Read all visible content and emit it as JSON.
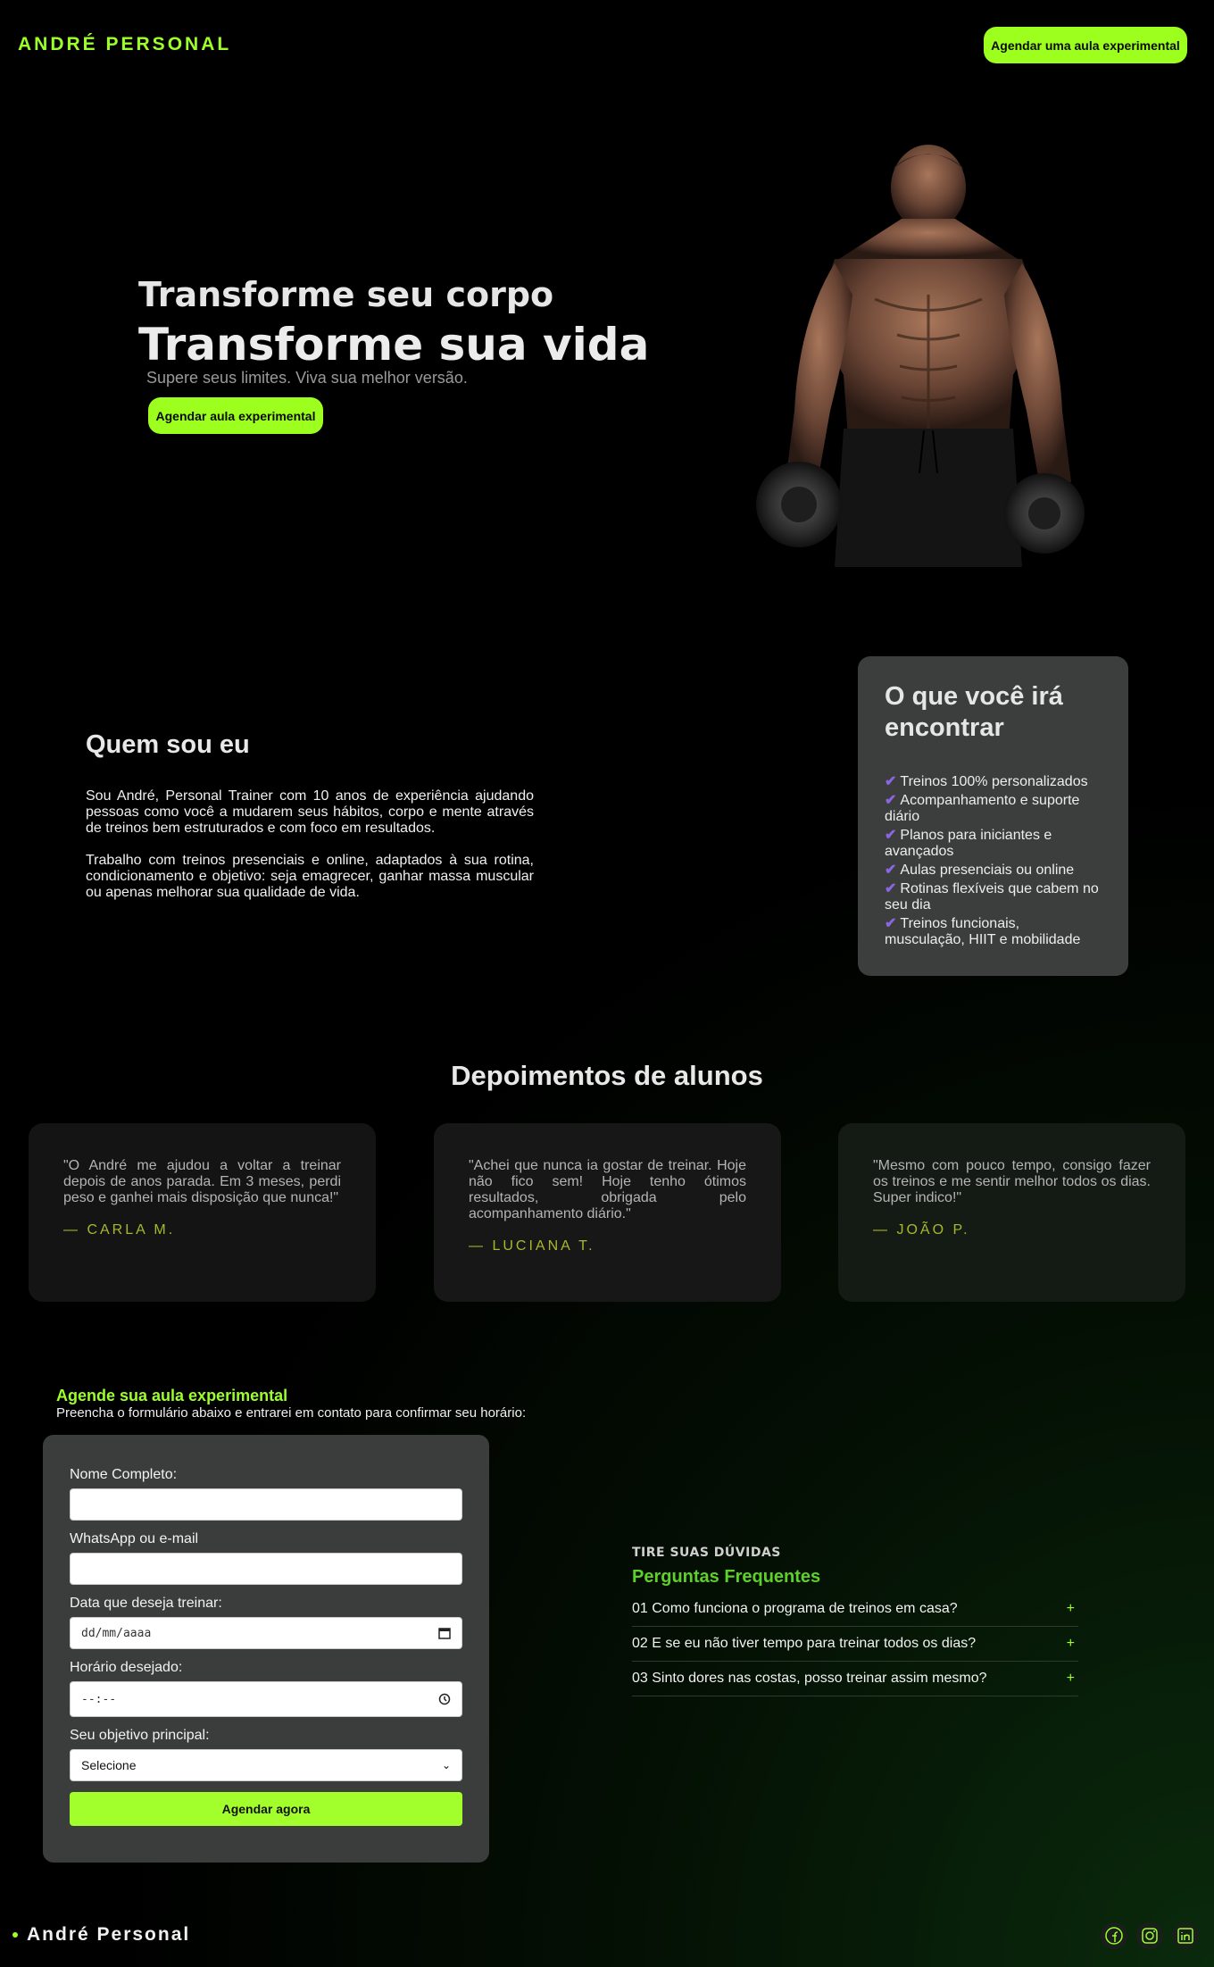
{
  "header": {
    "brand": "ANDRÉ PERSONAL",
    "cta_label": "Agendar uma aula experimental"
  },
  "hero": {
    "line1": "Transforme seu corpo",
    "line2": "Transforme sua vida",
    "subtitle": "Supere seus limites. Viva sua melhor versão.",
    "cta_label": "Agendar aula experimental"
  },
  "about": {
    "title": "Quem sou eu",
    "paragraphs": [
      "Sou André, Personal Trainer com 10 anos de experiência ajudando pessoas como você a mudarem seus hábitos, corpo e mente através de treinos bem estruturados e com foco em resultados.",
      "Trabalho com treinos presenciais e online, adaptados à sua rotina, condicionamento e objetivo: seja emagrecer, ganhar massa muscular ou apenas melhorar sua qualidade de vida."
    ]
  },
  "features": {
    "title": "O que você irá encontrar",
    "items": [
      "Treinos 100% personalizados",
      "Acompanhamento e suporte diário",
      "Planos para iniciantes e avançados",
      "Aulas presenciais ou online",
      "Rotinas flexíveis que cabem no seu dia",
      "Treinos funcionais, musculação, HIIT e mobilidade"
    ]
  },
  "testimonials": {
    "title": "Depoimentos de alunos",
    "items": [
      {
        "quote": "\"O André me ajudou a voltar a treinar depois de anos parada. Em 3 meses, perdi peso e ganhei mais disposição que nunca!\"",
        "author": "— CARLA M."
      },
      {
        "quote": "\"Achei que nunca ia gostar de treinar. Hoje não fico sem! Hoje tenho ótimos resultados, obrigada pelo acompanhamento diário.\"",
        "author": "— LUCIANA T."
      },
      {
        "quote": "\"Mesmo com pouco tempo, consigo fazer os treinos e me sentir melhor todos os dias. Super indico!\"",
        "author": "— JOÃO P."
      }
    ]
  },
  "form": {
    "kicker": "Agende sua aula experimental",
    "intro": "Preencha o formulário abaixo e entrarei em contato para confirmar seu horário:",
    "name_label": "Nome Completo:",
    "contact_label": "WhatsApp ou e-mail",
    "date_label": "Data que deseja treinar:",
    "date_placeholder": "dd/mm/aaaa",
    "time_label": "Horário desejado:",
    "time_placeholder": "--:--",
    "goal_label": "Seu objetivo principal:",
    "goal_selected": "Selecione",
    "submit_label": "Agendar agora"
  },
  "faq": {
    "kicker": "TIRE SUAS DÚVIDAS",
    "title": "Perguntas Frequentes",
    "items": [
      "01 Como funciona o programa de treinos em casa?",
      "02 E se eu não tiver tempo para treinar todos os dias?",
      "03 Sinto dores nas costas, posso treinar assim mesmo?"
    ],
    "toggle": "+"
  },
  "footer": {
    "brand": "André Personal",
    "social_icons": [
      "facebook-icon",
      "instagram-icon",
      "linkedin-icon"
    ]
  },
  "colors": {
    "accent": "#9cff2a",
    "check": "#8a66e0",
    "card": "#3c3e3e",
    "author": "#a9b82b"
  }
}
